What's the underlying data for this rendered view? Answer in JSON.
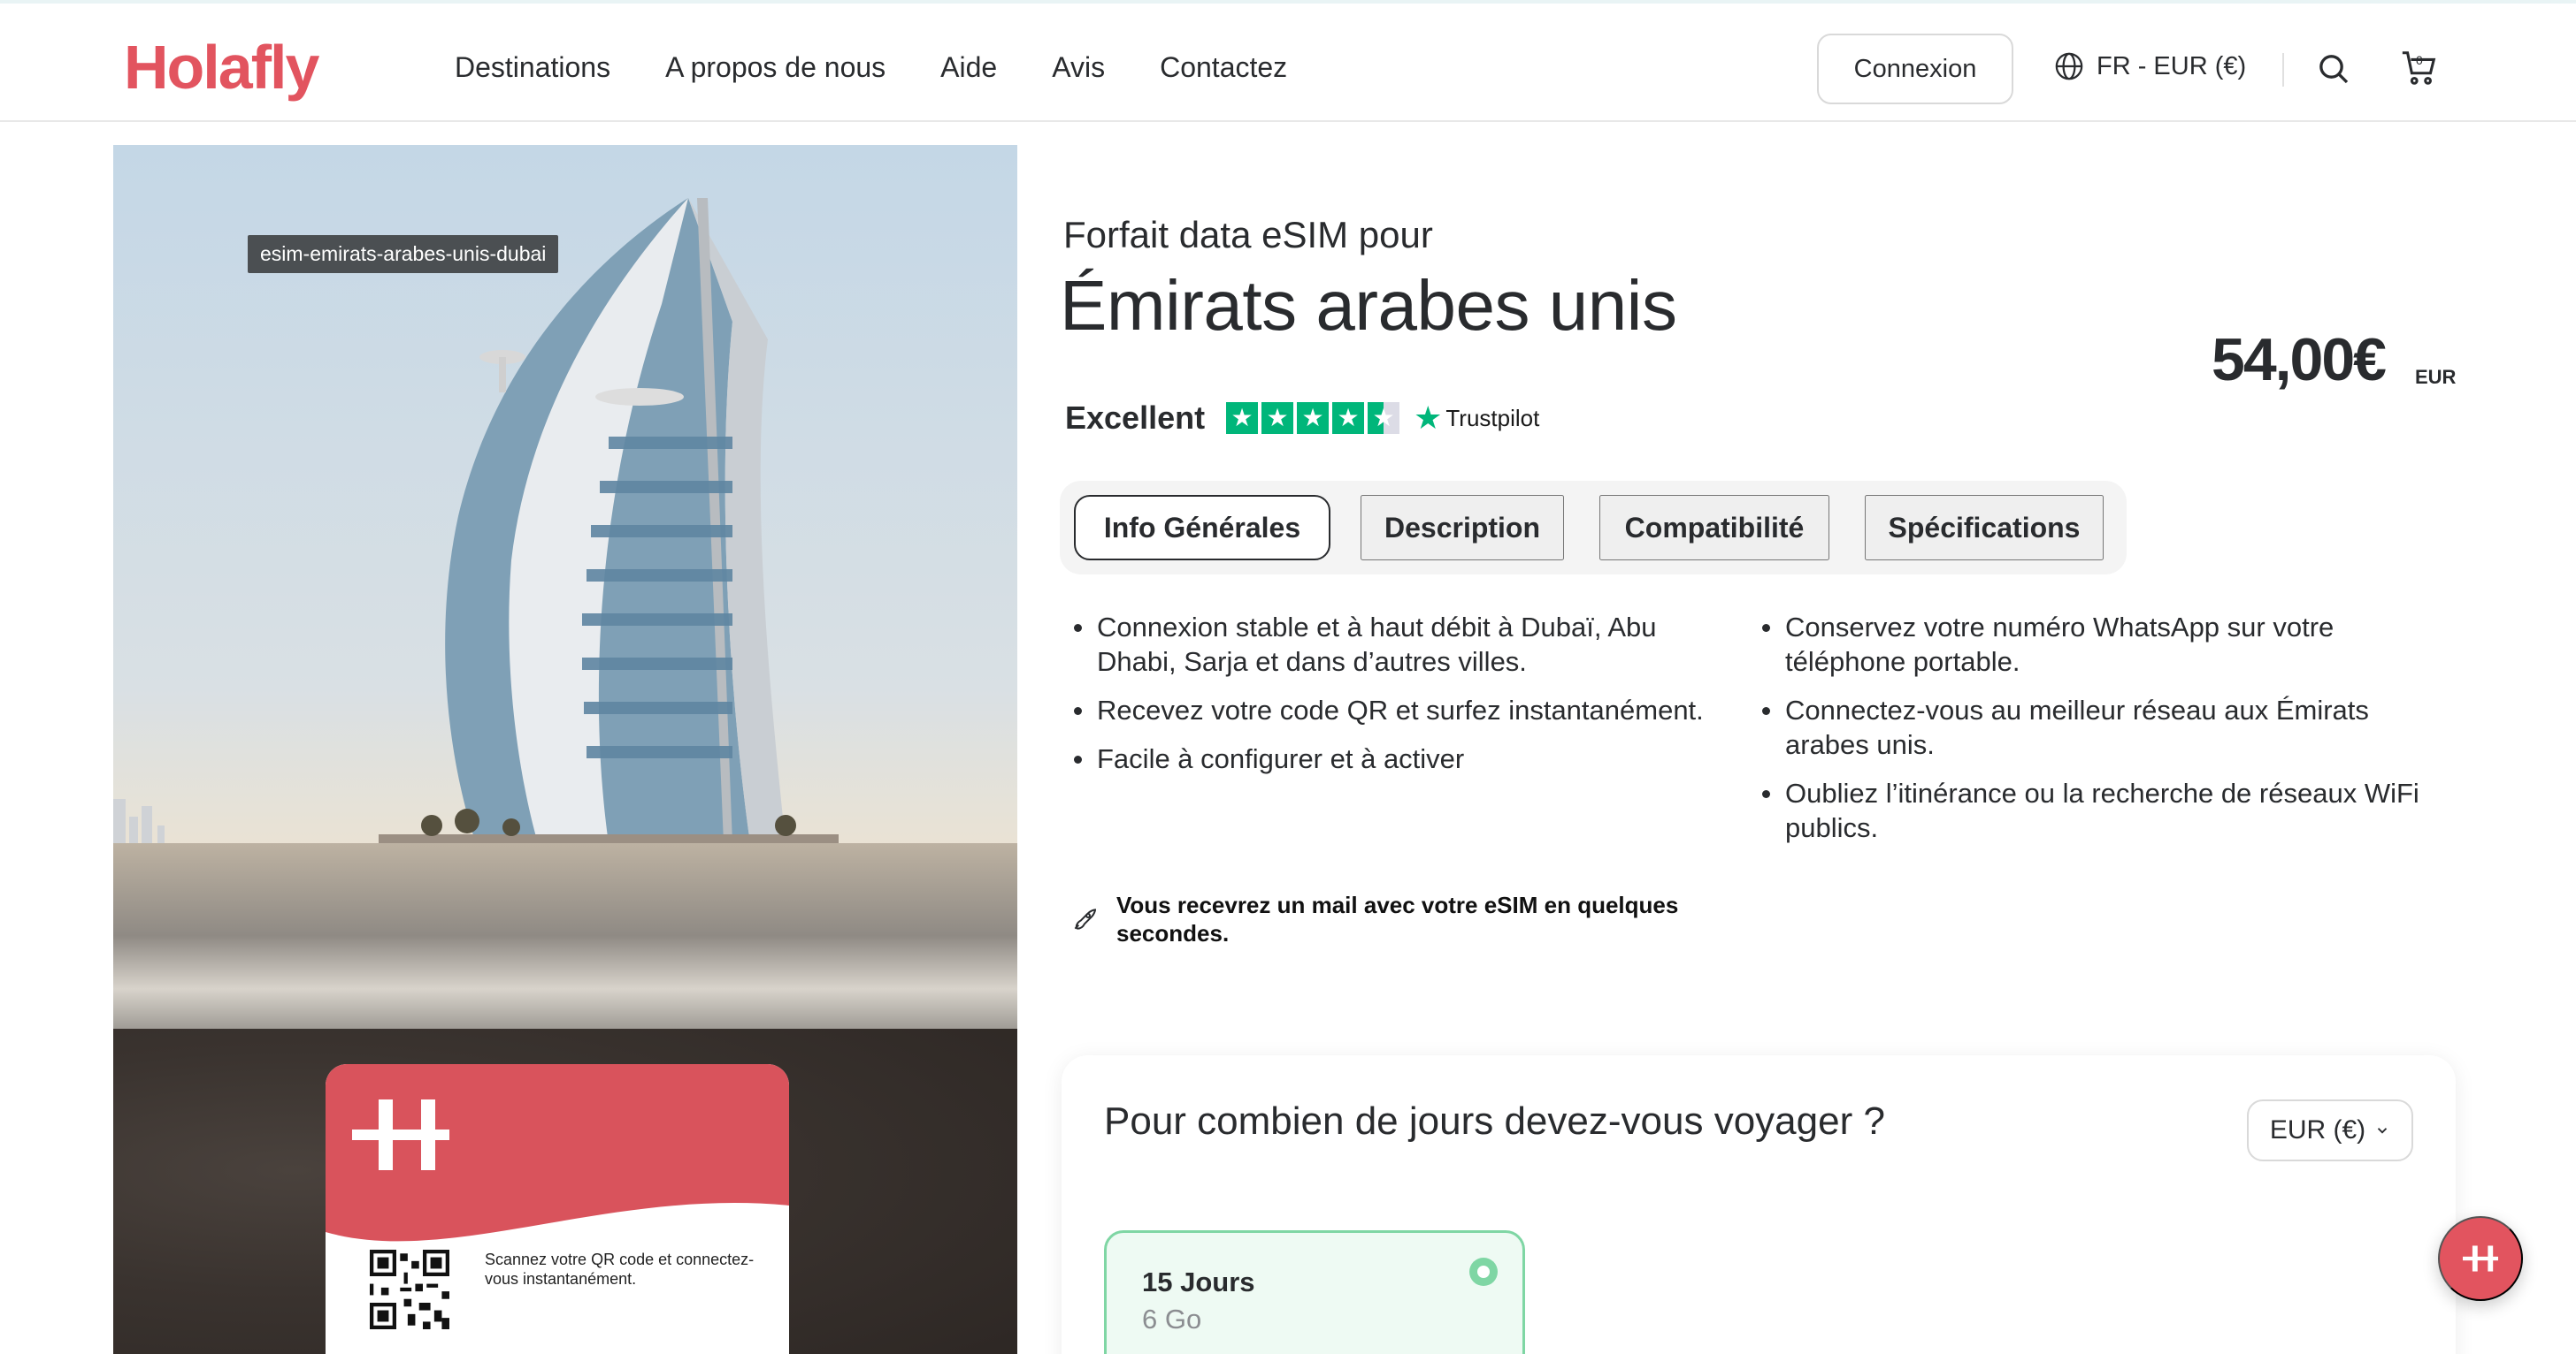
{
  "header": {
    "logo": "Holafly",
    "nav": [
      "Destinations",
      "A propos de nous",
      "Aide",
      "Avis",
      "Contactez"
    ],
    "login_label": "Connexion",
    "locale_label": "FR - EUR (€)",
    "cart_count": "0"
  },
  "hero": {
    "image_tag": "esim-emirats-arabes-unis-dubai",
    "card_text": "Scannez votre QR code et connectez-vous instantanément."
  },
  "product": {
    "subtitle": "Forfait data eSIM pour",
    "title": "Émirats arabes unis",
    "price": "54,00€",
    "price_currency": "EUR",
    "rating_word": "Excellent",
    "trustpilot_label": "Trustpilot",
    "rating_stars": 4.5
  },
  "tabs": [
    {
      "label": "Info Générales",
      "active": true
    },
    {
      "label": "Description",
      "active": false
    },
    {
      "label": "Compatibilité",
      "active": false
    },
    {
      "label": "Spécifications",
      "active": false
    }
  ],
  "info": {
    "left": [
      "Connexion stable et à haut débit à Dubaï, Abu Dhabi, Sarja et dans d’autres villes.",
      "Recevez votre code QR et surfez instantanément.",
      "Facile à configurer et à activer"
    ],
    "right": [
      "Conservez votre numéro WhatsApp sur votre téléphone portable.",
      "Connectez-vous au meilleur réseau aux Émirats arabes unis.",
      "Oubliez l’itinérance ou la recherche de réseaux WiFi publics."
    ],
    "notice": "Vous recevrez un mail avec votre eSIM en quelques secondes."
  },
  "plan": {
    "question": "Pour combien de jours devez-vous voyager ?",
    "currency_select": "EUR (€)",
    "options": [
      {
        "days": "15 Jours",
        "data": "6 Go",
        "selected": true
      }
    ]
  },
  "colors": {
    "brand": "#e2545f",
    "trustpilot": "#00b67a",
    "selected": "#7fd6a4"
  }
}
